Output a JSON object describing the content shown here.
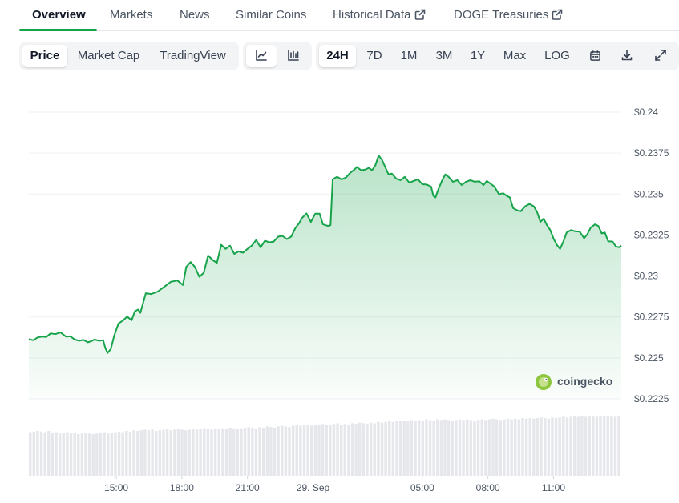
{
  "nav": {
    "tabs": [
      {
        "label": "Overview",
        "active": true
      },
      {
        "label": "Markets"
      },
      {
        "label": "News"
      },
      {
        "label": "Similar Coins"
      },
      {
        "label": "Historical Data",
        "external": true
      },
      {
        "label": "DOGE Treasuries",
        "external": true
      }
    ]
  },
  "toolbar": {
    "view_tabs": [
      "Price",
      "Market Cap",
      "TradingView"
    ],
    "selected_view": "Price",
    "chart_type_icons": [
      "line-chart-icon",
      "candlestick-chart-icon"
    ],
    "selected_chart_type": "line-chart-icon",
    "ranges": [
      "24H",
      "7D",
      "1M",
      "3M",
      "1Y",
      "Max",
      "LOG"
    ],
    "selected_range": "24H",
    "action_icons": [
      "calendar-icon",
      "download-icon",
      "fullscreen-icon"
    ]
  },
  "watermark": "coingecko",
  "colors": {
    "line": "#16a34a",
    "accent": "#16a34a",
    "volume": "#e5e7eb"
  },
  "chart_data": {
    "type": "area",
    "title": "",
    "xlabel": "",
    "ylabel": "",
    "y_ticks": [
      "$0.24",
      "$0.2375",
      "$0.235",
      "$0.2325",
      "$0.23",
      "$0.2275",
      "$0.225",
      "$0.2225"
    ],
    "ylim": [
      0.2225,
      0.24
    ],
    "x_ticks": [
      "15:00",
      "18:00",
      "21:00",
      "29. Sep",
      "05:00",
      "08:00",
      "11:00"
    ],
    "x_tick_hours": [
      15,
      18,
      21,
      24,
      29,
      32,
      35
    ],
    "grid": true,
    "series": [
      {
        "price": [
          [
            11.0,
            0.22615
          ],
          [
            11.2,
            0.22608
          ],
          [
            11.4,
            0.22625
          ],
          [
            11.6,
            0.2263
          ],
          [
            11.8,
            0.22628
          ],
          [
            12.0,
            0.2265
          ],
          [
            12.2,
            0.22645
          ],
          [
            12.45,
            0.22655
          ],
          [
            12.7,
            0.2263
          ],
          [
            12.9,
            0.22632
          ],
          [
            13.1,
            0.22612
          ],
          [
            13.3,
            0.22605
          ],
          [
            13.5,
            0.2261
          ],
          [
            13.7,
            0.22595
          ],
          [
            13.9,
            0.22605
          ],
          [
            14.0,
            0.22612
          ],
          [
            14.2,
            0.22605
          ],
          [
            14.4,
            0.22608
          ],
          [
            14.5,
            0.2256
          ],
          [
            14.6,
            0.2253
          ],
          [
            14.75,
            0.22555
          ],
          [
            14.9,
            0.22635
          ],
          [
            15.1,
            0.2271
          ],
          [
            15.3,
            0.22728
          ],
          [
            15.5,
            0.22752
          ],
          [
            15.7,
            0.2273
          ],
          [
            15.85,
            0.22785
          ],
          [
            16.0,
            0.22795
          ],
          [
            16.1,
            0.22775
          ],
          [
            16.35,
            0.22895
          ],
          [
            16.6,
            0.2289
          ],
          [
            16.9,
            0.22905
          ],
          [
            17.2,
            0.22935
          ],
          [
            17.5,
            0.22965
          ],
          [
            17.8,
            0.22972
          ],
          [
            18.05,
            0.22945
          ],
          [
            18.2,
            0.23055
          ],
          [
            18.4,
            0.23085
          ],
          [
            18.6,
            0.23055
          ],
          [
            18.8,
            0.22995
          ],
          [
            19.0,
            0.2302
          ],
          [
            19.2,
            0.23125
          ],
          [
            19.4,
            0.23098
          ],
          [
            19.6,
            0.2308
          ],
          [
            19.8,
            0.2319
          ],
          [
            20.0,
            0.23165
          ],
          [
            20.2,
            0.23185
          ],
          [
            20.4,
            0.23135
          ],
          [
            20.6,
            0.2315
          ],
          [
            20.8,
            0.23142
          ],
          [
            21.0,
            0.23165
          ],
          [
            21.2,
            0.23185
          ],
          [
            21.4,
            0.2322
          ],
          [
            21.6,
            0.23175
          ],
          [
            21.8,
            0.23215
          ],
          [
            22.0,
            0.23205
          ],
          [
            22.2,
            0.2321
          ],
          [
            22.4,
            0.2324
          ],
          [
            22.6,
            0.23245
          ],
          [
            22.8,
            0.23225
          ],
          [
            23.0,
            0.2324
          ],
          [
            23.2,
            0.23295
          ],
          [
            23.35,
            0.2332
          ],
          [
            23.5,
            0.23355
          ],
          [
            23.7,
            0.23382
          ],
          [
            23.9,
            0.2333
          ],
          [
            24.1,
            0.2338
          ],
          [
            24.3,
            0.2338
          ],
          [
            24.45,
            0.23315
          ],
          [
            24.7,
            0.23305
          ],
          [
            24.8,
            0.2331
          ],
          [
            24.9,
            0.2359
          ],
          [
            25.1,
            0.23605
          ],
          [
            25.3,
            0.2359
          ],
          [
            25.5,
            0.236
          ],
          [
            25.7,
            0.2363
          ],
          [
            25.9,
            0.2365
          ],
          [
            26.0,
            0.23665
          ],
          [
            26.2,
            0.23645
          ],
          [
            26.4,
            0.2365
          ],
          [
            26.55,
            0.2366
          ],
          [
            26.7,
            0.23645
          ],
          [
            26.85,
            0.23675
          ],
          [
            27.0,
            0.23735
          ],
          [
            27.15,
            0.2371
          ],
          [
            27.3,
            0.23665
          ],
          [
            27.45,
            0.2362
          ],
          [
            27.6,
            0.23625
          ],
          [
            27.8,
            0.23595
          ],
          [
            28.0,
            0.23585
          ],
          [
            28.2,
            0.23605
          ],
          [
            28.4,
            0.2357
          ],
          [
            28.6,
            0.2358
          ],
          [
            28.8,
            0.2359
          ],
          [
            29.0,
            0.2356
          ],
          [
            29.2,
            0.23558
          ],
          [
            29.4,
            0.23545
          ],
          [
            29.5,
            0.2349
          ],
          [
            29.6,
            0.2348
          ],
          [
            29.75,
            0.23535
          ],
          [
            29.9,
            0.23582
          ],
          [
            30.05,
            0.2362
          ],
          [
            30.2,
            0.23605
          ],
          [
            30.4,
            0.23575
          ],
          [
            30.6,
            0.23585
          ],
          [
            30.8,
            0.23555
          ],
          [
            31.0,
            0.23575
          ],
          [
            31.2,
            0.23585
          ],
          [
            31.4,
            0.23575
          ],
          [
            31.6,
            0.23578
          ],
          [
            31.8,
            0.23555
          ],
          [
            31.95,
            0.2358
          ],
          [
            32.1,
            0.23565
          ],
          [
            32.3,
            0.23545
          ],
          [
            32.5,
            0.235
          ],
          [
            32.7,
            0.23505
          ],
          [
            32.85,
            0.2349
          ],
          [
            33.0,
            0.2348
          ],
          [
            33.15,
            0.23415
          ],
          [
            33.35,
            0.234
          ],
          [
            33.5,
            0.23395
          ],
          [
            33.7,
            0.23425
          ],
          [
            33.9,
            0.2344
          ],
          [
            34.1,
            0.23425
          ],
          [
            34.25,
            0.2339
          ],
          [
            34.4,
            0.2333
          ],
          [
            34.55,
            0.2335
          ],
          [
            34.7,
            0.2331
          ],
          [
            34.85,
            0.2328
          ],
          [
            35.0,
            0.23228
          ],
          [
            35.15,
            0.2319
          ],
          [
            35.3,
            0.23165
          ],
          [
            35.45,
            0.2321
          ],
          [
            35.6,
            0.23265
          ],
          [
            35.8,
            0.2328
          ],
          [
            36.0,
            0.23272
          ],
          [
            36.2,
            0.2327
          ],
          [
            36.4,
            0.2323
          ],
          [
            36.55,
            0.23255
          ],
          [
            36.7,
            0.23295
          ],
          [
            36.9,
            0.23315
          ],
          [
            37.05,
            0.23305
          ],
          [
            37.2,
            0.2326
          ],
          [
            37.35,
            0.23265
          ],
          [
            37.5,
            0.23212
          ],
          [
            37.7,
            0.2321
          ],
          [
            37.85,
            0.2318
          ],
          [
            38.0,
            0.23175
          ],
          [
            38.1,
            0.23185
          ]
        ]
      }
    ],
    "volume_series": {
      "unit": "relative",
      "start_hour": 11.0,
      "end_hour": 38.1,
      "values": [
        0.68,
        0.69,
        0.7,
        0.69,
        0.68,
        0.7,
        0.67,
        0.68,
        0.66,
        0.67,
        0.68,
        0.66,
        0.67,
        0.65,
        0.66,
        0.67,
        0.66,
        0.65,
        0.66,
        0.67,
        0.68,
        0.66,
        0.67,
        0.68,
        0.69,
        0.68,
        0.7,
        0.69,
        0.71,
        0.7,
        0.71,
        0.72,
        0.71,
        0.72,
        0.7,
        0.71,
        0.72,
        0.73,
        0.71,
        0.72,
        0.73,
        0.72,
        0.71,
        0.72,
        0.73,
        0.72,
        0.73,
        0.74,
        0.73,
        0.72,
        0.74,
        0.73,
        0.74,
        0.73,
        0.75,
        0.74,
        0.73,
        0.74,
        0.75,
        0.76,
        0.75,
        0.74,
        0.76,
        0.75,
        0.77,
        0.76,
        0.75,
        0.77,
        0.78,
        0.77,
        0.76,
        0.78,
        0.79,
        0.78,
        0.8,
        0.79,
        0.78,
        0.8,
        0.79,
        0.81,
        0.8,
        0.79,
        0.81,
        0.82,
        0.8,
        0.81,
        0.8,
        0.82,
        0.81,
        0.83,
        0.82,
        0.81,
        0.83,
        0.82,
        0.84,
        0.83,
        0.84,
        0.85,
        0.84,
        0.86,
        0.85,
        0.86,
        0.85,
        0.87,
        0.86,
        0.87,
        0.86,
        0.88,
        0.87,
        0.86,
        0.88,
        0.87,
        0.88,
        0.87,
        0.86,
        0.87,
        0.88,
        0.87,
        0.88,
        0.87,
        0.86,
        0.87,
        0.88,
        0.87,
        0.88,
        0.89,
        0.88,
        0.87,
        0.88,
        0.89,
        0.88,
        0.89,
        0.88,
        0.9,
        0.89,
        0.9,
        0.89,
        0.9,
        0.91,
        0.9,
        0.89,
        0.91,
        0.9,
        0.91,
        0.92,
        0.91,
        0.92,
        0.93,
        0.92,
        0.93,
        0.92,
        0.94,
        0.93,
        0.92,
        0.94,
        0.93,
        0.94,
        0.93,
        0.92,
        0.94
      ]
    }
  }
}
